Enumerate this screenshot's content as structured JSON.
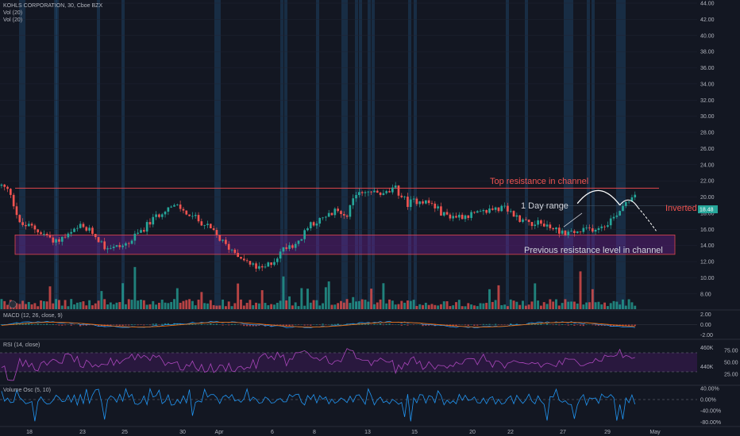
{
  "header": {
    "symbol_line": "KOHLS CORPORATION, 30, Cboe BZX",
    "vol1": "Vol (20)",
    "vol2": "Vol (20)"
  },
  "panels": {
    "macd_label": "MACD (12, 26, close, 9)",
    "rsi_label": "RSI (14, close)",
    "volosc_label": "Volume Osc (5, 10)"
  },
  "annotations": {
    "top_resistance": "Top resistance in channel",
    "day_range": "1 Day range",
    "inverted": "Inverted",
    "prev_resistance": "Previous resistance level in channel"
  },
  "colors": {
    "background": "#131722",
    "up": "#26a69a",
    "down": "#ef5350",
    "resistance_line": "#e0474c",
    "zone_fill": "#7b1fa2",
    "annotation_red": "#ef5350",
    "annotation_white": "#d1d4dc",
    "rsi": "#ab47bc",
    "volosc": "#2196f3"
  },
  "chart_data": {
    "type": "candlestick",
    "x_tick_labels": [
      "18",
      "23",
      "25",
      "30",
      "Apr",
      "6",
      "8",
      "13",
      "15",
      "20",
      "22",
      "27",
      "29",
      "May"
    ],
    "price_axis": {
      "ticks": [
        "44.00",
        "42.00",
        "40.00",
        "38.00",
        "36.00",
        "34.00",
        "32.00",
        "30.00",
        "28.00",
        "26.00",
        "24.00",
        "22.00",
        "20.00",
        "18.00",
        "16.00",
        "14.00",
        "12.00",
        "10.00",
        "8.00"
      ],
      "range": [
        7.0,
        44.0
      ],
      "current_price": "18.48",
      "current_value": 18.48
    },
    "resistance_line": 21.1,
    "resistance_zone": [
      12.9,
      15.3
    ],
    "price_path": [
      [
        0,
        21.4
      ],
      [
        3,
        20.5
      ],
      [
        6,
        16.6
      ],
      [
        10,
        16.3
      ],
      [
        14,
        15.4
      ],
      [
        18,
        14.6
      ],
      [
        22,
        15.2
      ],
      [
        26,
        16.3
      ],
      [
        30,
        15.6
      ],
      [
        34,
        13.9
      ],
      [
        38,
        13.8
      ],
      [
        42,
        14.3
      ],
      [
        46,
        15.8
      ],
      [
        50,
        17.2
      ],
      [
        54,
        18.6
      ],
      [
        58,
        18.8
      ],
      [
        62,
        17.8
      ],
      [
        66,
        16.9
      ],
      [
        70,
        15.6
      ],
      [
        74,
        14.0
      ],
      [
        78,
        13.0
      ],
      [
        82,
        11.6
      ],
      [
        86,
        11.0
      ],
      [
        90,
        12.2
      ],
      [
        94,
        14.0
      ],
      [
        98,
        14.3
      ],
      [
        102,
        16.8
      ],
      [
        106,
        17.2
      ],
      [
        110,
        18.2
      ],
      [
        114,
        18.0
      ],
      [
        118,
        20.8
      ],
      [
        122,
        20.6
      ],
      [
        126,
        20.3
      ],
      [
        130,
        21.0
      ],
      [
        134,
        19.2
      ],
      [
        138,
        19.7
      ],
      [
        142,
        19.1
      ],
      [
        146,
        17.8
      ],
      [
        150,
        17.6
      ],
      [
        154,
        17.8
      ],
      [
        158,
        17.9
      ],
      [
        162,
        18.6
      ],
      [
        166,
        18.5
      ],
      [
        170,
        17.5
      ],
      [
        174,
        16.9
      ],
      [
        178,
        16.7
      ],
      [
        182,
        16.1
      ],
      [
        186,
        15.6
      ],
      [
        190,
        15.6
      ],
      [
        194,
        16.0
      ],
      [
        198,
        16.4
      ],
      [
        202,
        17.5
      ],
      [
        206,
        19.5
      ],
      [
        210,
        20.8
      ],
      [
        214,
        20.3
      ],
      [
        218,
        20.4
      ],
      [
        222,
        18.8
      ],
      [
        226,
        18.4
      ]
    ],
    "volume_range": [
      0,
      60
    ],
    "macd_ticks": [
      "2.00",
      "0.00",
      "-2.00"
    ],
    "macd_range": [
      -2.5,
      2.5
    ],
    "rsi_ticks": [
      "75.00",
      "50.00",
      "25.00"
    ],
    "rsi_side_ticks": [
      "460K",
      "440K"
    ],
    "rsi_range": [
      5,
      95
    ],
    "rsi_band": [
      30,
      70
    ],
    "volosc_ticks": [
      "40.00%",
      "0.00%",
      "-40.00%",
      "-80.00%"
    ],
    "volosc_range": [
      -90,
      45
    ]
  }
}
